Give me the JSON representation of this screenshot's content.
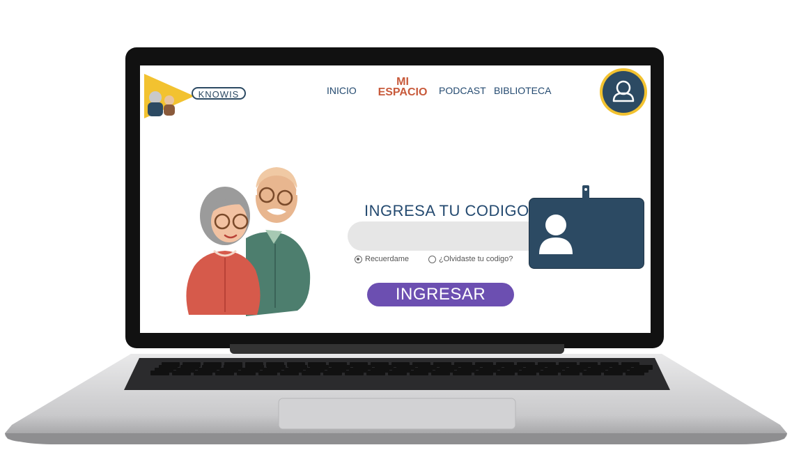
{
  "nav": {
    "logo_text": "KNOWIS",
    "items": [
      "INICIO",
      "PODCAST",
      "BIBLIOTECA"
    ],
    "active_line1": "MI",
    "active_line2": "ESPACIO",
    "profile_icon": "user-icon"
  },
  "login": {
    "title": "INGRESA TU CODIGO",
    "code_value": "",
    "remember_label": "Recuerdame",
    "remember_checked": true,
    "forgot_label": "¿Olvidaste tu codigo?",
    "submit_label": "INGRESAR"
  },
  "colors": {
    "navy": "#2c4a63",
    "accent_red": "#c85a3b",
    "button_purple": "#6c4fb1",
    "logo_yellow": "#f2c230"
  }
}
